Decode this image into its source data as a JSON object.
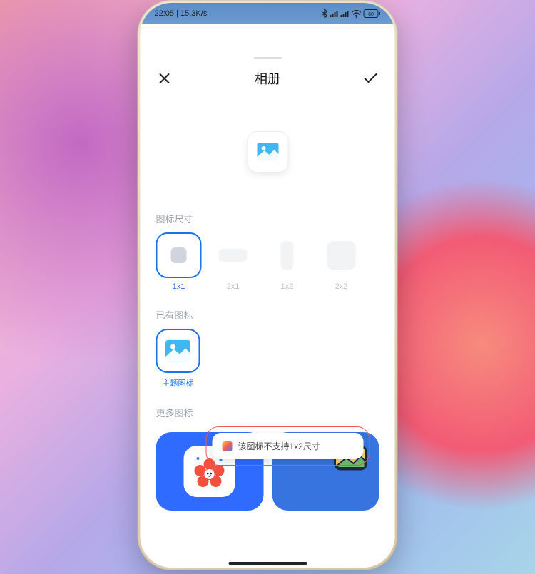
{
  "status": {
    "time": "22:05",
    "net": "15.3K/s"
  },
  "title": "相册",
  "sections": {
    "size_label": "图标尺寸",
    "exist_label": "已有图标",
    "more_label": "更多图标"
  },
  "sizes": [
    {
      "label": "1x1",
      "shape": "square",
      "selected": true
    },
    {
      "label": "2x1",
      "shape": "wide",
      "selected": false
    },
    {
      "label": "1x2",
      "shape": "tall",
      "selected": false
    },
    {
      "label": "2x2",
      "shape": "big",
      "selected": false
    }
  ],
  "existing": [
    {
      "label": "主题图标",
      "selected": true
    }
  ],
  "toast": "该图标不支持1x2尺寸"
}
